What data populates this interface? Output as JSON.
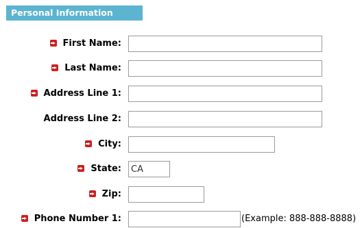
{
  "section": {
    "title": "Personal Information"
  },
  "fields": {
    "first_name": {
      "label": "First Name:",
      "value": ""
    },
    "last_name": {
      "label": "Last Name:",
      "value": ""
    },
    "address1": {
      "label": "Address Line 1:",
      "value": ""
    },
    "address2": {
      "label": "Address Line 2:",
      "value": ""
    },
    "city": {
      "label": "City:",
      "value": ""
    },
    "state": {
      "label": "State:",
      "value": "CA"
    },
    "zip": {
      "label": "Zip:",
      "value": ""
    },
    "phone1": {
      "label": "Phone Number 1:",
      "value": "",
      "hint": "(Example: 888-888-8888)"
    }
  },
  "colors": {
    "header_bg": "#5bb4d0",
    "required_marker": "#cc1f1f"
  },
  "icons": {
    "required": "required-arrow-icon"
  }
}
